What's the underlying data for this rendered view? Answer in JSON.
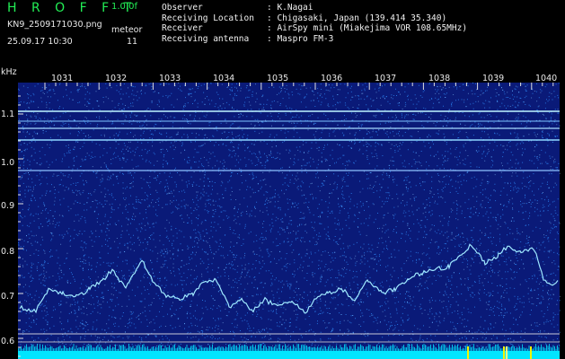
{
  "header": {
    "brand": "H R O F F T",
    "version": "1.0.0f",
    "filename": "KN9_2509171030.png",
    "meteor_label": "meteor",
    "meteor_count": "11",
    "datetime": "25.09.17 10:30",
    "meta": [
      {
        "key": "Observer",
        "value": ": K.Nagai"
      },
      {
        "key": "Receiving Location",
        "value": ": Chigasaki, Japan (139.414 35.340)"
      },
      {
        "key": "Receiver",
        "value": ": AirSpy mini (Miakejima VOR 108.65MHz)"
      },
      {
        "key": "Receiving antenna",
        "value": ": Maspro FM-3"
      }
    ]
  },
  "spectrogram": {
    "y_unit": "kHz",
    "x_ticks": [
      "1031",
      "1032",
      "1033",
      "1034",
      "1035",
      "1036",
      "1037",
      "1038",
      "1039",
      "1040"
    ],
    "y_ticks": [
      "1.1",
      "1.0",
      "0.9",
      "0.8",
      "0.7",
      "0.6"
    ],
    "y_range_khz": [
      0.58,
      1.18
    ],
    "background_color": "#0a1a78",
    "noise_color": "#2f8fff",
    "trace_color": "#9fe8ff",
    "baseline_color": "#00e5ff"
  }
}
